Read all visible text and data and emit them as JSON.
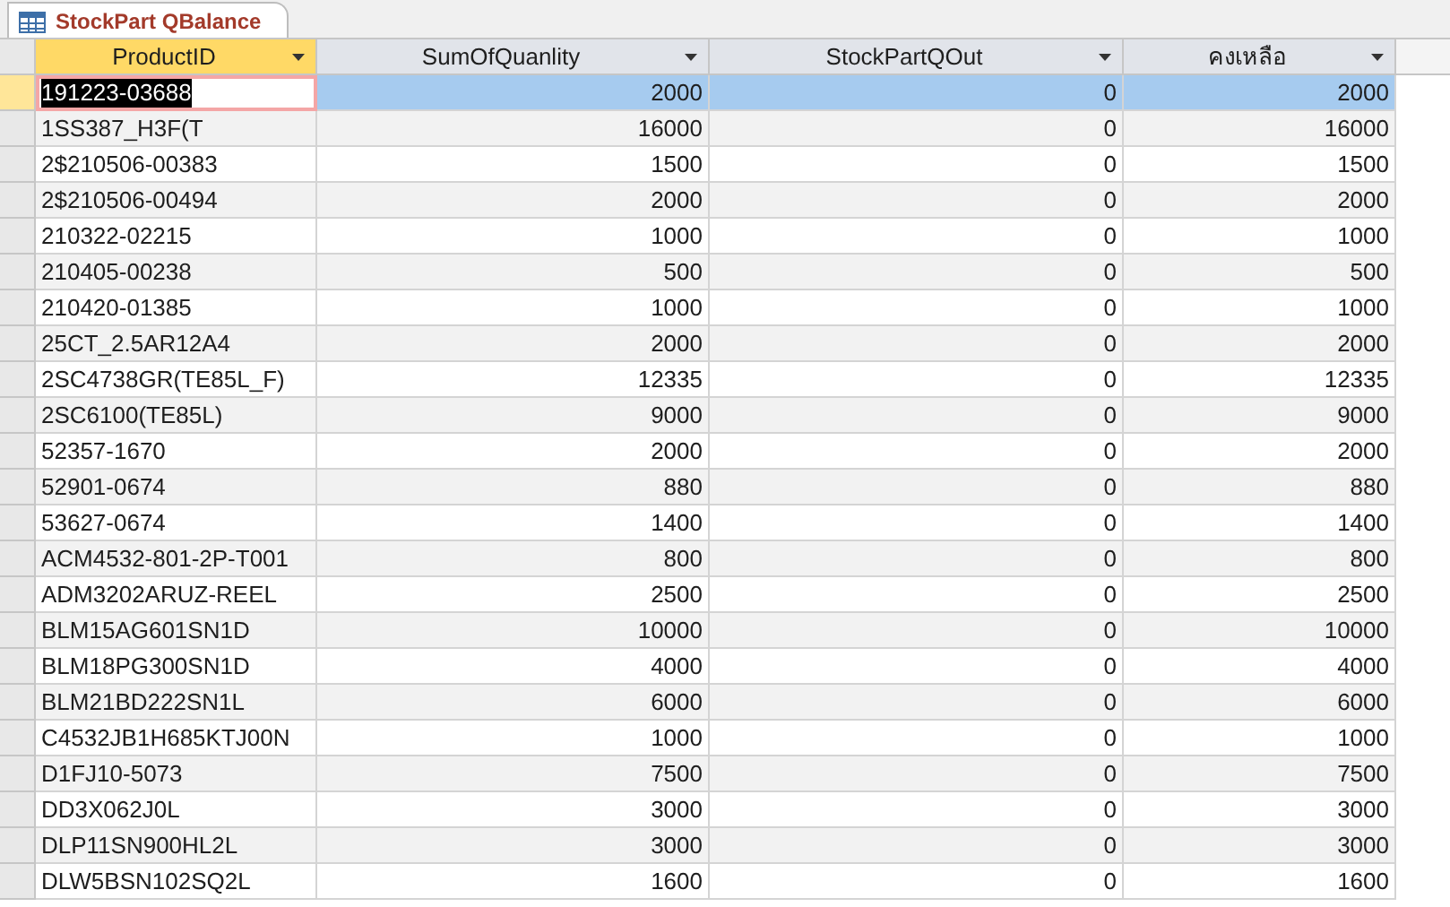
{
  "tab": {
    "title": "StockPart QBalance",
    "selected": true
  },
  "columns": [
    {
      "label": "ProductID",
      "selected": true
    },
    {
      "label": "SumOfQuanlity",
      "selected": false
    },
    {
      "label": "StockPartQOut",
      "selected": false
    },
    {
      "label": "คงเหลือ",
      "selected": false
    }
  ],
  "rows": [
    {
      "cells": [
        "191223-03688",
        "2000",
        "0",
        "2000"
      ],
      "selected": true
    },
    {
      "cells": [
        "1SS387_H3F(T",
        "16000",
        "0",
        "16000"
      ],
      "selected": false
    },
    {
      "cells": [
        "2$210506-00383",
        "1500",
        "0",
        "1500"
      ],
      "selected": false
    },
    {
      "cells": [
        "2$210506-00494",
        "2000",
        "0",
        "2000"
      ],
      "selected": false
    },
    {
      "cells": [
        "210322-02215",
        "1000",
        "0",
        "1000"
      ],
      "selected": false
    },
    {
      "cells": [
        "210405-00238",
        "500",
        "0",
        "500"
      ],
      "selected": false
    },
    {
      "cells": [
        "210420-01385",
        "1000",
        "0",
        "1000"
      ],
      "selected": false
    },
    {
      "cells": [
        "25CT_2.5AR12A4",
        "2000",
        "0",
        "2000"
      ],
      "selected": false
    },
    {
      "cells": [
        "2SC4738GR(TE85L_F)",
        "12335",
        "0",
        "12335"
      ],
      "selected": false
    },
    {
      "cells": [
        "2SC6100(TE85L)",
        "9000",
        "0",
        "9000"
      ],
      "selected": false
    },
    {
      "cells": [
        "52357-1670",
        "2000",
        "0",
        "2000"
      ],
      "selected": false
    },
    {
      "cells": [
        "52901-0674",
        "880",
        "0",
        "880"
      ],
      "selected": false
    },
    {
      "cells": [
        "53627-0674",
        "1400",
        "0",
        "1400"
      ],
      "selected": false
    },
    {
      "cells": [
        "ACM4532-801-2P-T001",
        "800",
        "0",
        "800"
      ],
      "selected": false
    },
    {
      "cells": [
        "ADM3202ARUZ-REEL",
        "2500",
        "0",
        "2500"
      ],
      "selected": false
    },
    {
      "cells": [
        "BLM15AG601SN1D",
        "10000",
        "0",
        "10000"
      ],
      "selected": false
    },
    {
      "cells": [
        "BLM18PG300SN1D",
        "4000",
        "0",
        "4000"
      ],
      "selected": false
    },
    {
      "cells": [
        "BLM21BD222SN1L",
        "6000",
        "0",
        "6000"
      ],
      "selected": false
    },
    {
      "cells": [
        "C4532JB1H685KTJ00N",
        "1000",
        "0",
        "1000"
      ],
      "selected": false
    },
    {
      "cells": [
        "D1FJ10-5073",
        "7500",
        "0",
        "7500"
      ],
      "selected": false
    },
    {
      "cells": [
        "DD3X062J0L",
        "3000",
        "0",
        "3000"
      ],
      "selected": false
    },
    {
      "cells": [
        "DLP11SN900HL2L",
        "3000",
        "0",
        "3000"
      ],
      "selected": false
    },
    {
      "cells": [
        "DLW5BSN102SQ2L",
        "1600",
        "0",
        "1600"
      ],
      "selected": false
    }
  ]
}
